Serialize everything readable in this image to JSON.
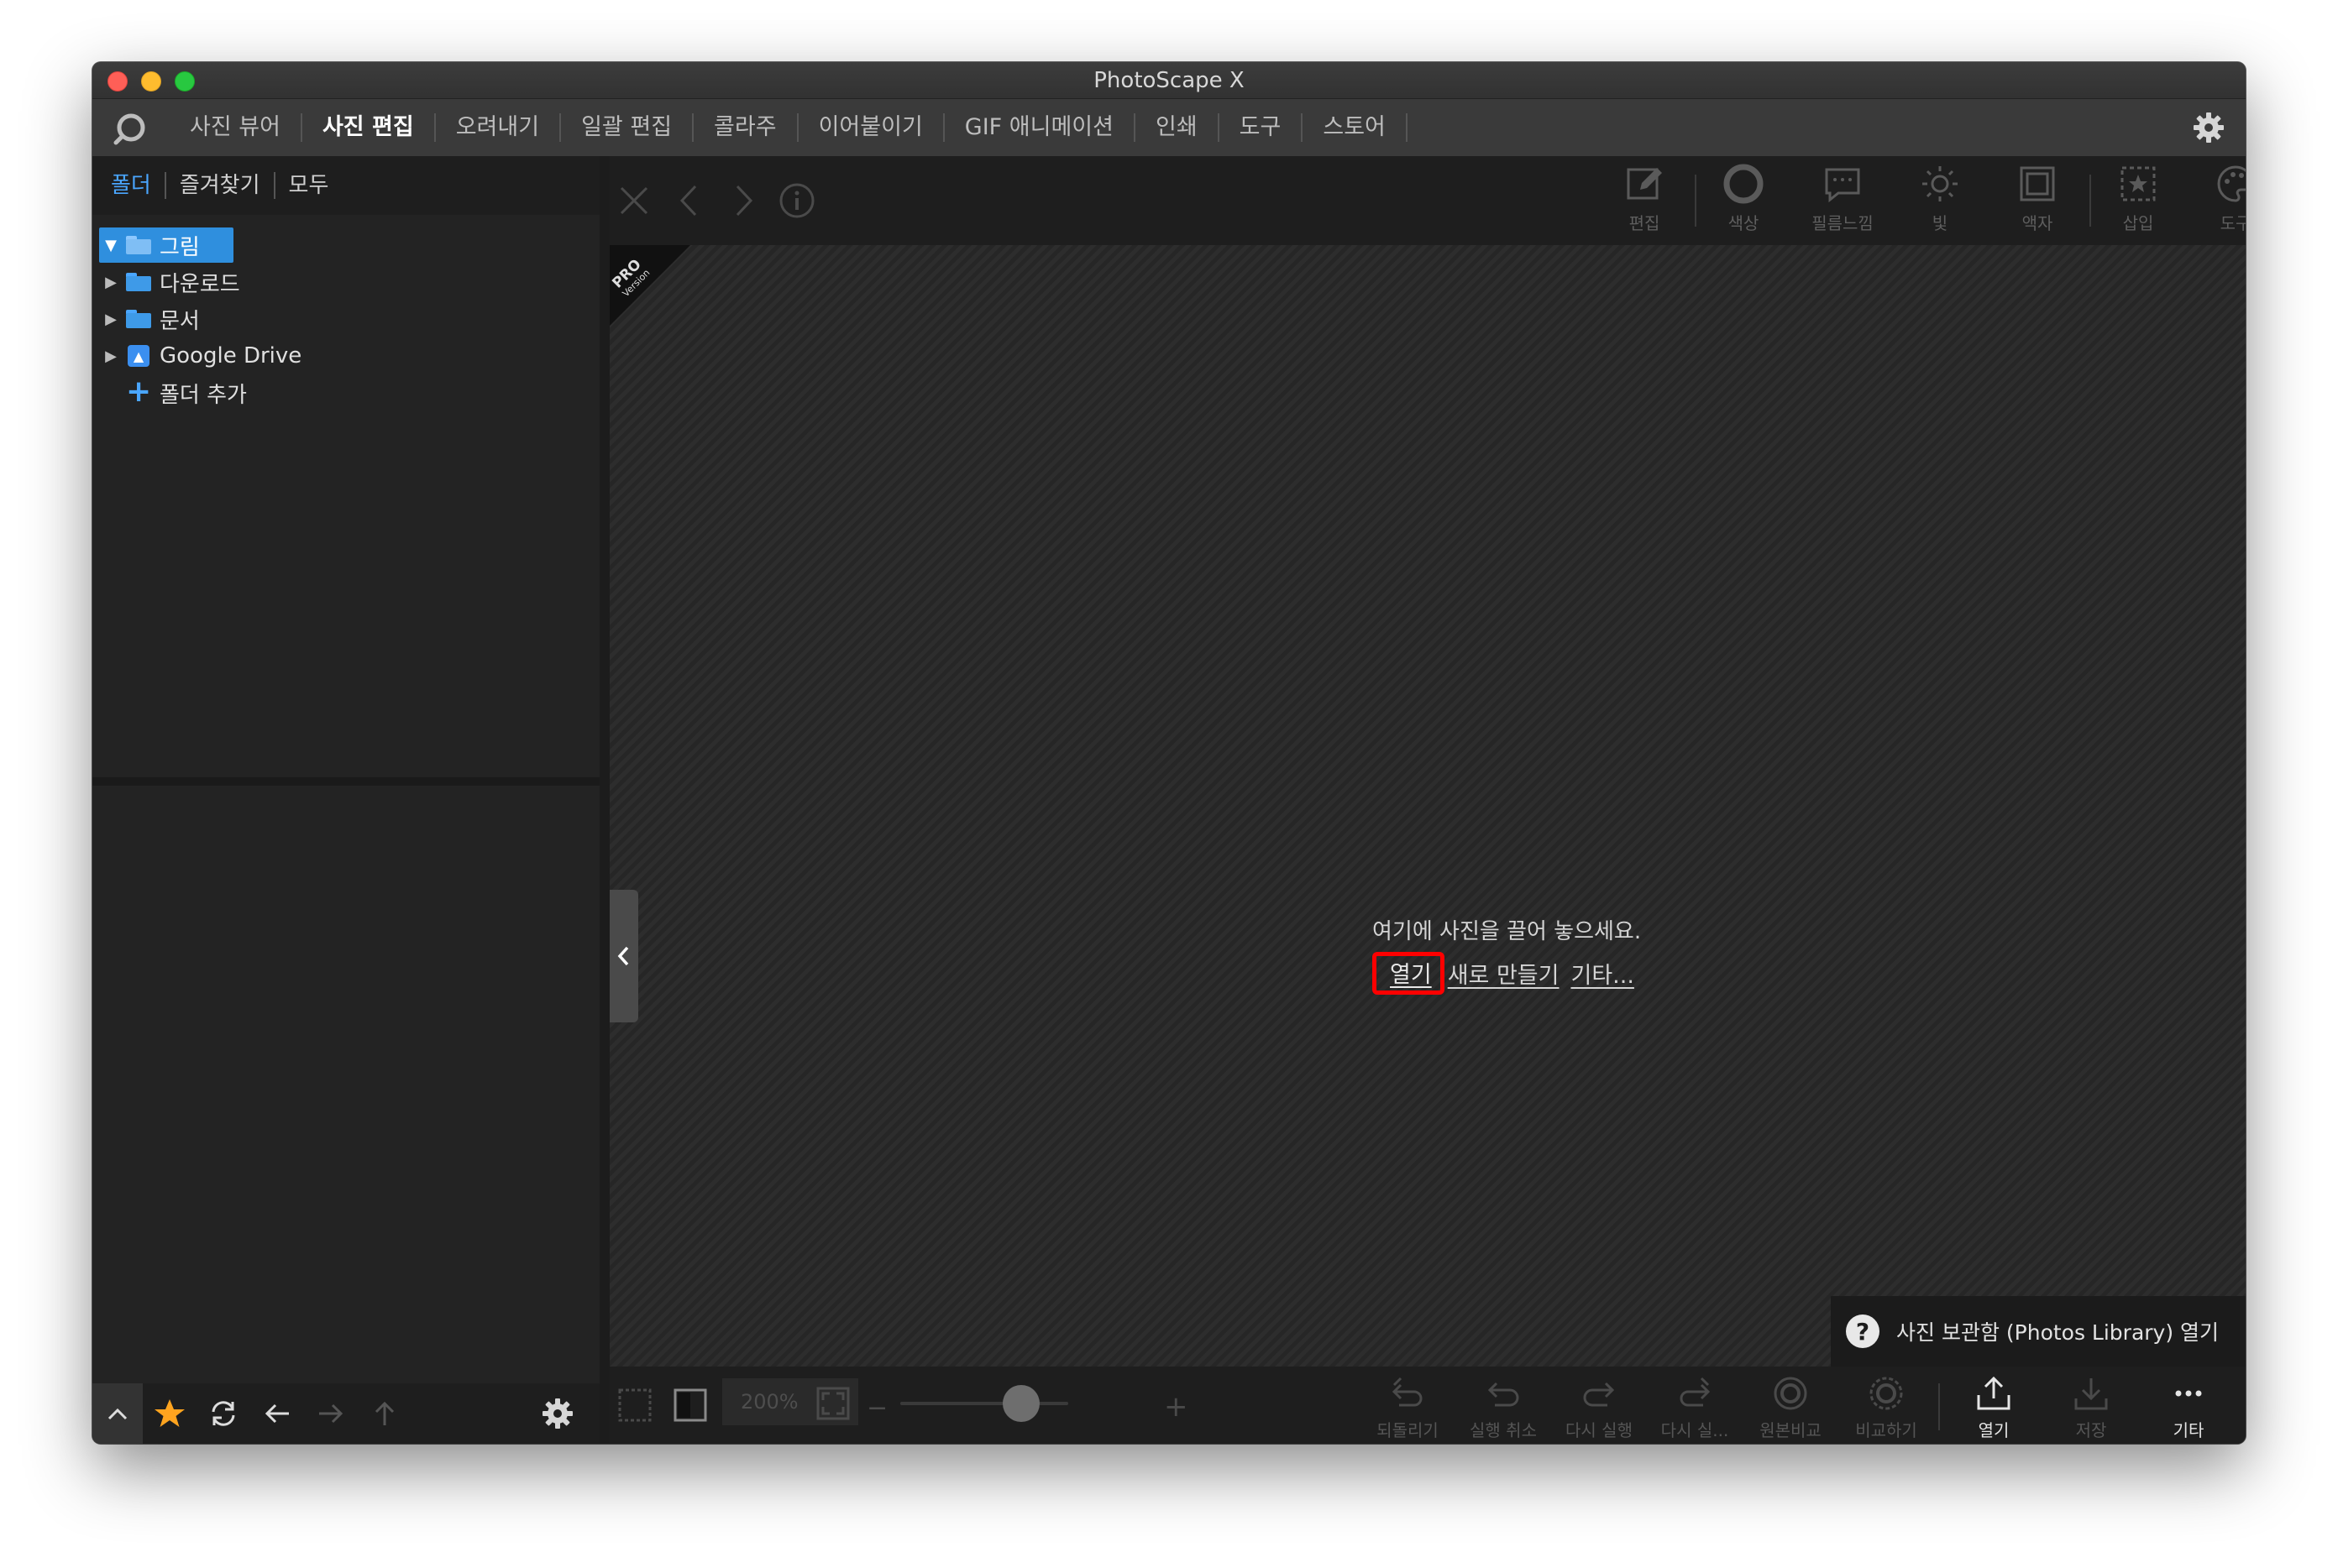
{
  "window": {
    "title": "PhotoScape X"
  },
  "menu": {
    "items": [
      "사진 뷰어",
      "사진 편집",
      "오려내기",
      "일괄 편집",
      "콜라주",
      "이어붙이기",
      "GIF 애니메이션",
      "인쇄",
      "도구",
      "스토어"
    ],
    "active_index": 1
  },
  "left_panel": {
    "tabs": [
      "폴더",
      "즐겨찾기",
      "모두"
    ],
    "active_tab": 0,
    "tree": [
      {
        "label": "그림",
        "expanded": true,
        "selected": true,
        "icon": "folder-icon"
      },
      {
        "label": "다운로드",
        "expanded": false,
        "selected": false,
        "icon": "folder-icon"
      },
      {
        "label": "문서",
        "expanded": false,
        "selected": false,
        "icon": "folder-icon"
      },
      {
        "label": "Google Drive",
        "expanded": false,
        "selected": false,
        "icon": "google-drive-icon"
      },
      {
        "label": "폴더 추가",
        "icon": "plus-icon"
      }
    ]
  },
  "top_tools": [
    "편집",
    "색상",
    "필름느낌",
    "빛",
    "액자",
    "삽입",
    "도구"
  ],
  "canvas": {
    "badge_main": "PRO",
    "badge_sub": "Version",
    "drop_message": "여기에 사진을 끌어 놓으세요.",
    "links": {
      "open": "열기",
      "new": "새로 만들기",
      "other": "기타..."
    }
  },
  "photos_library": {
    "label": "사진 보관함 (Photos Library) 열기"
  },
  "bottom": {
    "zoom": "200%",
    "tools": [
      "되돌리기",
      "실행 취소",
      "다시 실행",
      "다시 실...",
      "원본비교",
      "비교하기",
      "열기",
      "저장",
      "기타"
    ]
  },
  "colors": {
    "accent": "#2f8fde",
    "highlight": "#ff0000",
    "background": "#1e1e1e"
  }
}
